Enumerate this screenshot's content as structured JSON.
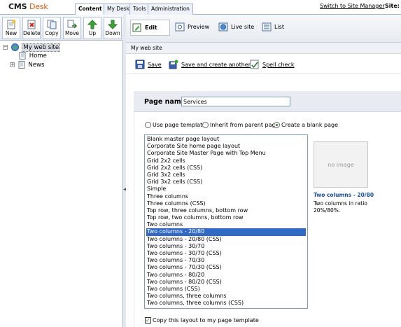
{
  "app": {
    "logo_main": "CMS",
    "logo_sub": "Desk"
  },
  "tabs": [
    {
      "label": "Content",
      "active": true
    },
    {
      "label": "My Desk",
      "active": false
    },
    {
      "label": "Tools",
      "active": false
    },
    {
      "label": "Administration",
      "active": false
    }
  ],
  "header_right": {
    "switch_link": "Switch to Site Manager",
    "site_label": "Site:"
  },
  "toolbar": {
    "new": "New",
    "delete": "Delete",
    "copy": "Copy",
    "move": "Move",
    "up": "Up",
    "down": "Down"
  },
  "tree": {
    "root": "My web site",
    "children": [
      "Home",
      "News"
    ]
  },
  "modes": {
    "edit": "Edit",
    "preview": "Preview",
    "live": "Live site",
    "list": "List"
  },
  "breadcrumb": "My web site",
  "actions": {
    "save": "Save",
    "save_create": "Save and create another",
    "spell": "Spell check"
  },
  "form": {
    "page_name_label": "Page name:",
    "page_name_value": "Services",
    "options": [
      "Use page template",
      "Inherit from parent page",
      "Create a blank page"
    ],
    "selected_option": "Create a blank page"
  },
  "templates": [
    "Blank master page layout",
    "Corporate Site home page layout",
    "Corporate Site Master Page with Top Menu",
    "Grid 2x2 cells",
    "Grid 2x2 cells (CSS)",
    "Grid 3x2 cells",
    "Grid 3x2 cells (CSS)",
    "Simple",
    "Three columns",
    "Three columns (CSS)",
    "Top row, three columns, bottom row",
    "Top row, two columns, bottom row",
    "Two columns",
    "Two columns - 20/80",
    "Two columns - 20/80 (CSS)",
    "Two columns - 30/70",
    "Two columns - 30/70 (CSS)",
    "Two columns - 70/30",
    "Two columns - 70/30 (CSS)",
    "Two columns - 80/20",
    "Two columns - 80/20 (CSS)",
    "Two columns (CSS)",
    "Two columns, three columns",
    "Two columns, three columns (CSS)"
  ],
  "selected_template": "Two columns - 20/80",
  "preview": {
    "placeholder": "no image",
    "title": "Two columns - 20/80",
    "description": "Two columns in ratio 20%/80%."
  },
  "copy_layout": {
    "label": "Copy this layout to my page template",
    "checked": true
  },
  "colors": {
    "selection": "#316ac5",
    "logo_accent": "#d05a12",
    "link_blue": "#1a4f9c"
  }
}
